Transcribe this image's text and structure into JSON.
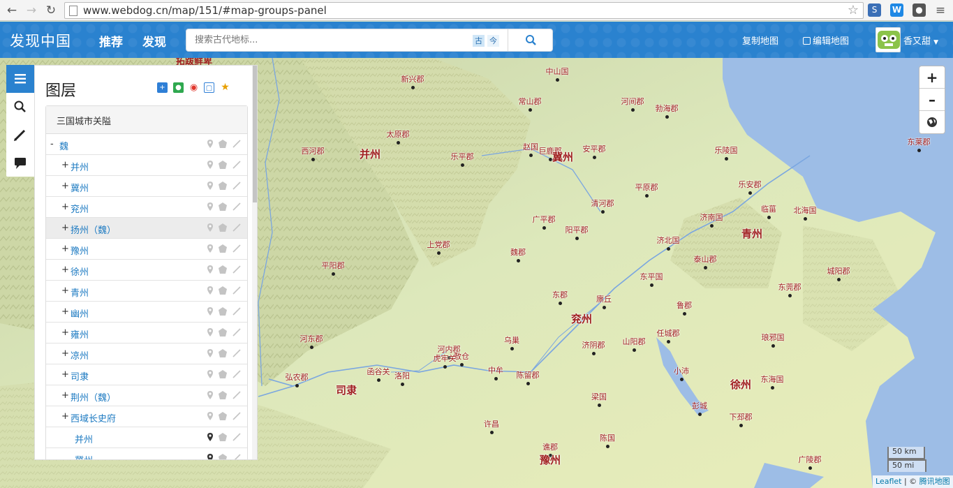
{
  "browser": {
    "url": "www.webdog.cn/map/151/#map-groups-panel"
  },
  "header": {
    "brand": "发现中国",
    "nav": [
      "推荐",
      "发现"
    ],
    "search_placeholder": "搜索古代地标...",
    "toggle_ancient": "古",
    "toggle_modern": "今",
    "copy_map": "复制地图",
    "edit_map": "编辑地图",
    "user_name": "香又甜"
  },
  "panel": {
    "title": "图层",
    "group_title": "三国城市关隘",
    "root": {
      "toggle": "-",
      "label": "魏"
    },
    "items": [
      {
        "toggle": "+",
        "label": "并州"
      },
      {
        "toggle": "+",
        "label": "冀州"
      },
      {
        "toggle": "+",
        "label": "兖州"
      },
      {
        "toggle": "+",
        "label": "扬州（魏）"
      },
      {
        "toggle": "+",
        "label": "豫州"
      },
      {
        "toggle": "+",
        "label": "徐州"
      },
      {
        "toggle": "+",
        "label": "青州"
      },
      {
        "toggle": "+",
        "label": "幽州"
      },
      {
        "toggle": "+",
        "label": "雍州"
      },
      {
        "toggle": "+",
        "label": "凉州"
      },
      {
        "toggle": "+",
        "label": "司隶"
      },
      {
        "toggle": "+",
        "label": "荆州（魏）"
      },
      {
        "toggle": "+",
        "label": "西域长史府"
      }
    ],
    "sub_items": [
      {
        "label": "并州"
      },
      {
        "label": "冀州"
      }
    ]
  },
  "map": {
    "places": [
      {
        "name": "中山国"
      },
      {
        "name": "新兴郡"
      },
      {
        "name": "常山郡"
      },
      {
        "name": "河间郡"
      },
      {
        "name": "勃海郡"
      },
      {
        "name": "太原郡"
      },
      {
        "name": "西河郡"
      },
      {
        "name": "乐平郡"
      },
      {
        "name": "赵国"
      },
      {
        "name": "巨鹿郡"
      },
      {
        "name": "安平郡"
      },
      {
        "name": "乐陵国"
      },
      {
        "name": "东莱郡"
      },
      {
        "name": "乐安郡"
      },
      {
        "name": "平原郡"
      },
      {
        "name": "清河郡"
      },
      {
        "name": "临菑"
      },
      {
        "name": "北海国"
      },
      {
        "name": "广平郡"
      },
      {
        "name": "阳平郡"
      },
      {
        "name": "济南国"
      },
      {
        "name": "上党郡"
      },
      {
        "name": "济北国"
      },
      {
        "name": "平阳郡"
      },
      {
        "name": "魏郡"
      },
      {
        "name": "泰山郡"
      },
      {
        "name": "城阳郡"
      },
      {
        "name": "东平国"
      },
      {
        "name": "东郡"
      },
      {
        "name": "廪丘"
      },
      {
        "name": "鲁郡"
      },
      {
        "name": "东莞郡"
      },
      {
        "name": "河东郡"
      },
      {
        "name": "乌巢"
      },
      {
        "name": "任城郡"
      },
      {
        "name": "琅邪国"
      },
      {
        "name": "济阴郡"
      },
      {
        "name": "山阳郡"
      },
      {
        "name": "河内郡"
      },
      {
        "name": "敖仓"
      },
      {
        "name": "虎牢关"
      },
      {
        "name": "弘农郡"
      },
      {
        "name": "函谷关"
      },
      {
        "name": "洛阳"
      },
      {
        "name": "中牟"
      },
      {
        "name": "陈留郡"
      },
      {
        "name": "小沛"
      },
      {
        "name": "东海国"
      },
      {
        "name": "梁国"
      },
      {
        "name": "彭城"
      },
      {
        "name": "下邳郡"
      },
      {
        "name": "许昌"
      },
      {
        "name": "谯郡"
      },
      {
        "name": "陈国"
      },
      {
        "name": "广陵郡"
      }
    ],
    "regions": [
      {
        "name": "并州"
      },
      {
        "name": "冀州"
      },
      {
        "name": "青州"
      },
      {
        "name": "兖州"
      },
      {
        "name": "司隶"
      },
      {
        "name": "徐州"
      },
      {
        "name": "豫州"
      }
    ],
    "top_cut_label": "拓跋鲜卑",
    "scale_km": "50 km",
    "scale_mi": "50 mi",
    "attribution_prefix": "Leaflet",
    "attribution_sep": " | © ",
    "attribution_provider": "腾讯地图"
  },
  "colors": {
    "header": "#2a82cf",
    "place_label": "#a02020",
    "link": "#1e7bc2",
    "sea": "#9dbde6",
    "river": "#7aa6e0"
  }
}
